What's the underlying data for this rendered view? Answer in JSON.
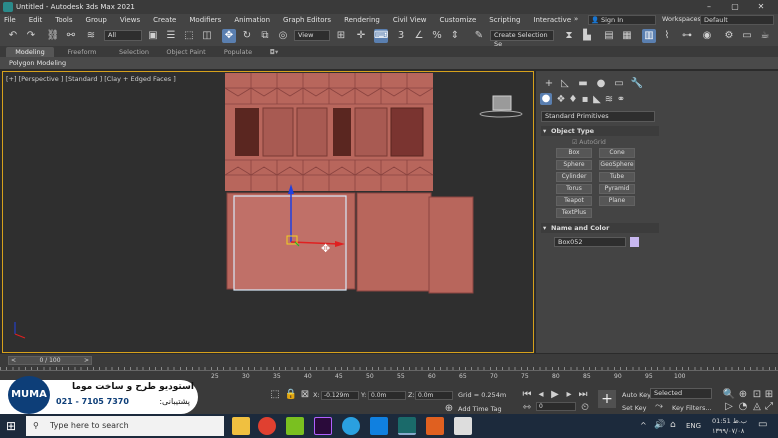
{
  "window": {
    "title": "Untitled - Autodesk 3ds Max 2021",
    "controls": [
      "–",
      "▢",
      "✕"
    ]
  },
  "menu": [
    "File",
    "Edit",
    "Tools",
    "Group",
    "Views",
    "Create",
    "Modifiers",
    "Animation",
    "Graph Editors",
    "Rendering",
    "Civil View",
    "Customize",
    "Scripting",
    "Interactive"
  ],
  "menu_more": "»",
  "signin": "Sign In",
  "workspaces": {
    "label": "Workspaces:",
    "value": "Default"
  },
  "toolbar": {
    "selection_filter": "All",
    "reference": "View",
    "selection_set": "Create Selection Se",
    "three": "3"
  },
  "ribbon": {
    "tabs": [
      "Modeling",
      "Freeform",
      "Selection",
      "Object Paint",
      "Populate"
    ],
    "active": "Modeling",
    "sub": "Polygon Modeling"
  },
  "viewport": {
    "label": "[+] [Perspective ] [Standard ] [Clay + Edged Faces ]"
  },
  "command_panel": {
    "category": "Standard Primitives",
    "object_type_title": "Object Type",
    "autogrid": "AutoGrid",
    "buttons": [
      "Box",
      "Cone",
      "Sphere",
      "GeoSphere",
      "Cylinder",
      "Tube",
      "Torus",
      "Pyramid",
      "Teapot",
      "Plane",
      "TextPlus"
    ],
    "name_color_title": "Name and Color",
    "object_name": "Box052",
    "object_color": "#c8b8f0"
  },
  "timeline": {
    "slider": "0 / 100",
    "prev": "<",
    "next": ">",
    "ticks": [
      "25",
      "30",
      "35",
      "40",
      "45",
      "50",
      "55",
      "60",
      "65",
      "70",
      "75",
      "80",
      "85",
      "90",
      "95",
      "100"
    ]
  },
  "status": {
    "x_label": "X:",
    "x": "-0.129m",
    "y_label": "Y:",
    "y": "0.0m",
    "z_label": "Z:",
    "z": "0.0m",
    "grid": "Grid = 0.254m",
    "add_time_tag": "Add Time Tag",
    "auto_key": "Auto Key",
    "set_key": "Set Key",
    "selected": "Selected",
    "key_filters": "Key Filters...",
    "frame": "0"
  },
  "banner": {
    "logo": "MUMA",
    "line1": "استودیو طرح و ساخت موما",
    "line2_label": "پشتیبانی:",
    "phone": "021 - 7105 7370"
  },
  "taskbar": {
    "search_placeholder": "Type here to search",
    "lang": "ENG",
    "time": "01:51 ب.ظ",
    "date": "۱۳۹۹/۰۷/۰۸"
  }
}
